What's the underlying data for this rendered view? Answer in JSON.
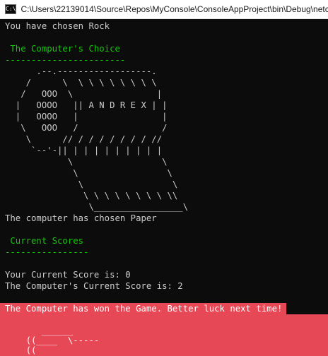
{
  "window": {
    "title": "C:\\Users\\22139014\\Source\\Repos\\MyConsole\\ConsoleAppProject\\bin\\Debug\\netc",
    "icon_label": "C:\\",
    "icon_name": "console-app-icon"
  },
  "console": {
    "player_choice_line": "You have chosen Rock",
    "computer_choice_heading": " The Computer's Choice",
    "computer_choice_rule": "-----------------------",
    "paper_art": [
      "      .--.------------------.",
      "    /      \\  \\ \\ \\ \\ \\ \\ \\ \\",
      "   /   OOO  \\                |",
      "  |   OOOO   || A N D R E X | |",
      "  |   OOOO   |                |",
      "   \\   OOO   /                /",
      "    \\      // / / / / / / / //",
      "     `--'-|| | | | | | | | | |",
      "            \\                 \\",
      "             \\                 \\",
      "              \\                 \\",
      "               \\ \\ \\ \\ \\ \\ \\ \\ \\\\",
      "                \\_________________\\"
    ],
    "computer_result_line": "The computer has chosen Paper",
    "scores_heading": " Current Scores",
    "scores_rule": "----------------",
    "player_score_line": "Your Current Score is: 0",
    "computer_score_line": "The Computer's Current Score is: 2",
    "game_over_line": "The Computer has won the Game. Better luck next time!",
    "bottom_art": [
      "       ______",
      "    ((____  \\-----",
      "    ((",
      "      ----"
    ]
  },
  "colors": {
    "console_background": "#0c0c0c",
    "console_text": "#cccccc",
    "heading_green": "#16c60c",
    "result_red": "#e74856"
  }
}
